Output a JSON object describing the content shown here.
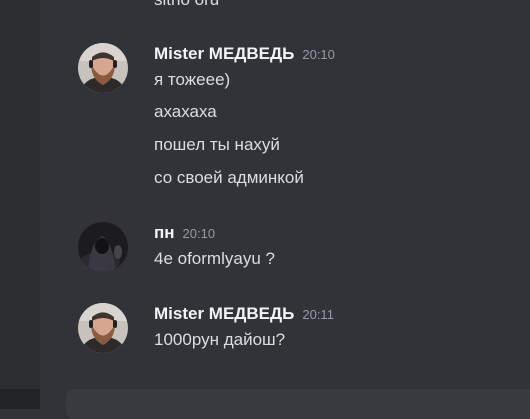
{
  "top_cut_message": "sitho oru",
  "messages": [
    {
      "username": "Mister МЕДВЕДЬ",
      "time": "20:10",
      "lines": [
        "я  тожеее)",
        "ахахаха",
        "пошел ты нахуй",
        "со своей админкой"
      ]
    },
    {
      "username": "пн",
      "time": "20:10",
      "lines": [
        "4е oformlyayu ?"
      ]
    },
    {
      "username": "Mister МЕДВЕДЬ",
      "time": "20:11",
      "lines": [
        "1000рун дайош?"
      ]
    }
  ],
  "colors": {
    "background": "#313338",
    "sidebar": "#2b2d31",
    "username": "#f2f3f5",
    "text": "#dbdee1",
    "timestamp": "#949ba4",
    "composer": "#383a40"
  }
}
